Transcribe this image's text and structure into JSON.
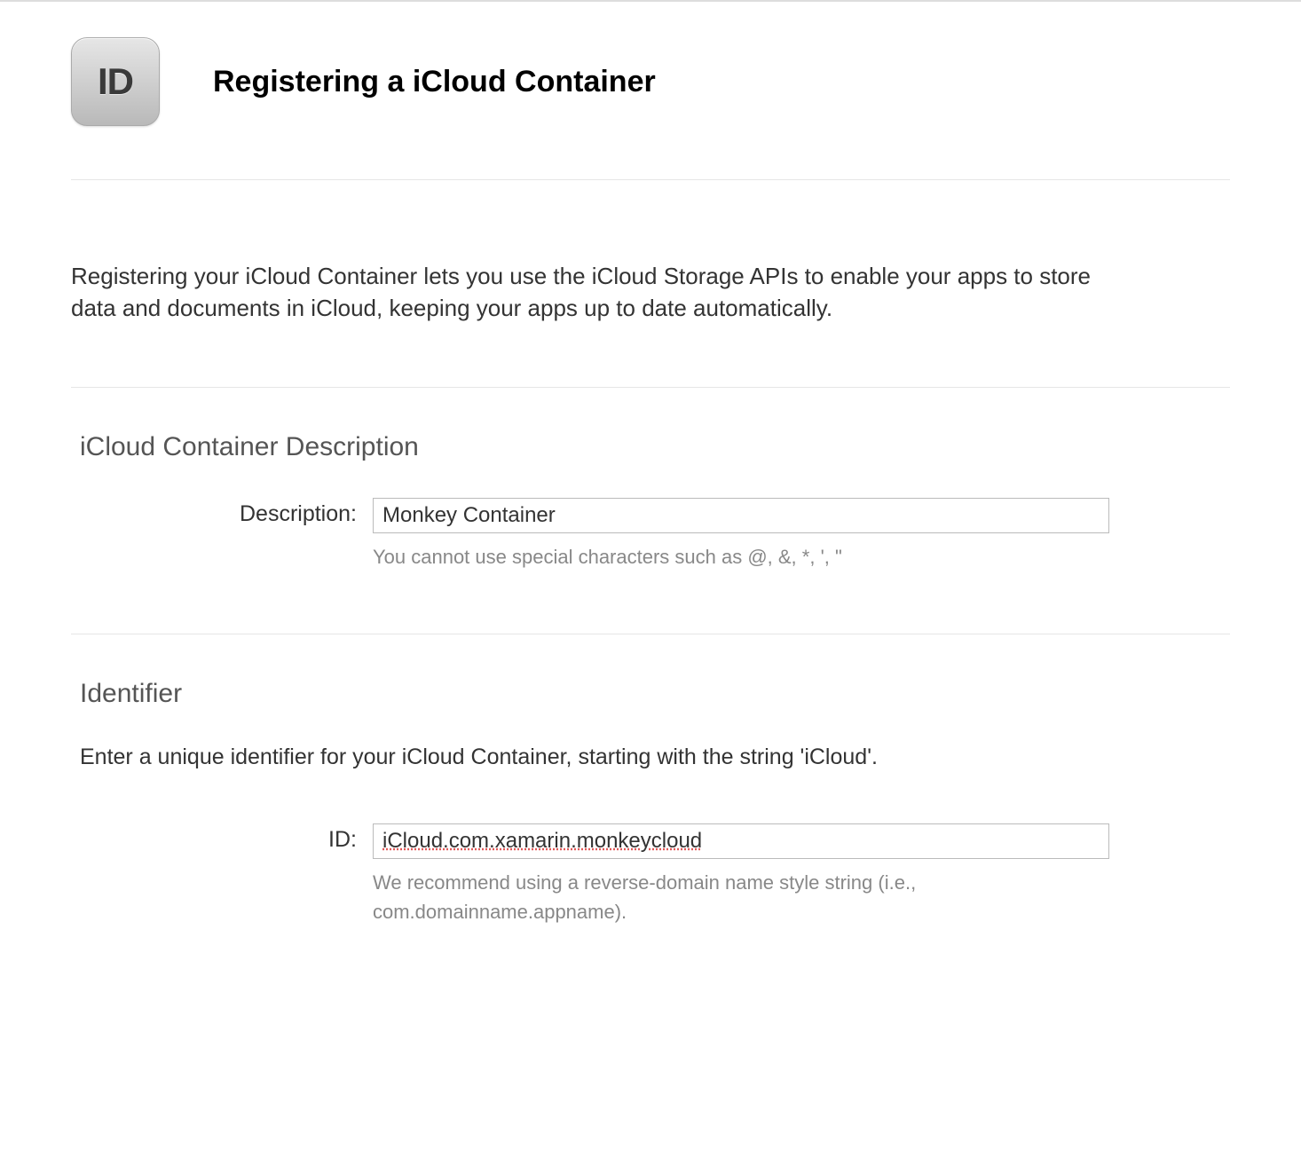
{
  "badge_text": "ID",
  "page_title": "Registering a iCloud Container",
  "intro_text": "Registering your iCloud Container lets you use the iCloud Storage APIs to enable your apps to store data and documents in iCloud, keeping your apps up to date automatically.",
  "description_section": {
    "heading": "iCloud Container Description",
    "label": "Description:",
    "value": "Monkey Container",
    "hint": "You cannot use special characters such as @, &, *, ', \""
  },
  "identifier_section": {
    "heading": "Identifier",
    "subtext": "Enter a unique identifier for your iCloud Container, starting with the string 'iCloud'.",
    "label": "ID:",
    "value": "iCloud.com.xamarin.monkeycloud",
    "hint": "We recommend using a reverse-domain name style string (i.e., com.domainname.appname)."
  }
}
